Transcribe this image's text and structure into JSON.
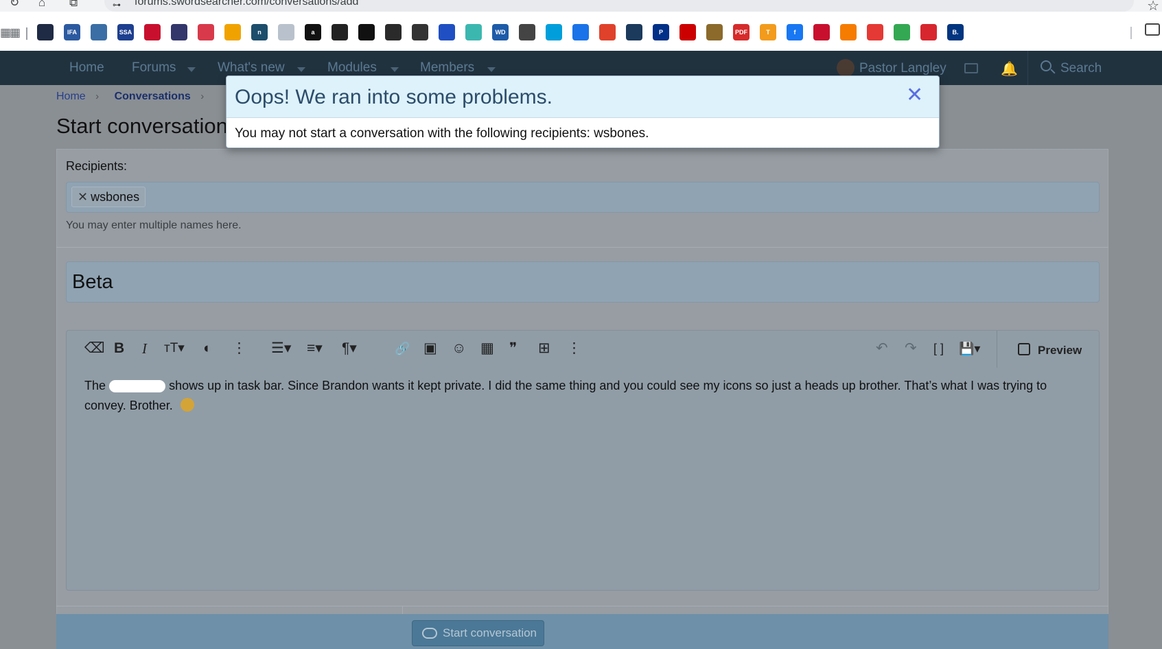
{
  "browser": {
    "url": "forums.swordsearcher.com/conversations/add",
    "nav_reload_glyph": "↻",
    "nav_home_glyph": "⌂",
    "nav_tabs_glyph": "⧉",
    "site_info_glyph": "⊶",
    "star_glyph": "☆",
    "apps_glyph": "▦▦",
    "bookmarks": [
      {
        "label": "",
        "icon": "calendar-icon",
        "color": "#1f2a44"
      },
      {
        "label": "IFA",
        "icon": "ifa-icon",
        "color": "#2c5aa0"
      },
      {
        "label": "",
        "icon": "globe-seal-icon",
        "color": "#3a6ea5"
      },
      {
        "label": "SSA",
        "icon": "ssa-icon",
        "color": "#1d3f8f"
      },
      {
        "label": "",
        "icon": "shield-red-icon",
        "color": "#c8102e"
      },
      {
        "label": "",
        "icon": "usps-icon",
        "color": "#33366b"
      },
      {
        "label": "",
        "icon": "red-envelope-icon",
        "color": "#d83a4b"
      },
      {
        "label": "",
        "icon": "feather-icon",
        "color": "#f0a300"
      },
      {
        "label": "n",
        "icon": "n-icon",
        "color": "#1d4e6b"
      },
      {
        "label": "",
        "icon": "doc-icon",
        "color": "#b9c2cc"
      },
      {
        "label": "a",
        "icon": "amazon-icon",
        "color": "#111111"
      },
      {
        "label": "",
        "icon": "amazon-box-icon",
        "color": "#222222"
      },
      {
        "label": "",
        "icon": "globe-dark-icon",
        "color": "#111111"
      },
      {
        "label": "",
        "icon": "badge-icon",
        "color": "#2a2a2a"
      },
      {
        "label": "",
        "icon": "globe-grey-icon",
        "color": "#333333"
      },
      {
        "label": "",
        "icon": "israel-flag-icon",
        "color": "#1f4fc2"
      },
      {
        "label": "",
        "icon": "leaf-icon",
        "color": "#3bb7b0"
      },
      {
        "label": "WD",
        "icon": "wd-icon",
        "color": "#1d5ba8"
      },
      {
        "label": "",
        "icon": "globe-icon",
        "color": "#444444"
      },
      {
        "label": "",
        "icon": "att-icon",
        "color": "#009fdb"
      },
      {
        "label": "",
        "icon": "g-icon",
        "color": "#1a73e8"
      },
      {
        "label": "",
        "icon": "aarp-icon",
        "color": "#e0412b"
      },
      {
        "label": "",
        "icon": "medal-icon",
        "color": "#1b3a5c"
      },
      {
        "label": "P",
        "icon": "paypal-icon",
        "color": "#003087"
      },
      {
        "label": "",
        "icon": "target-icon",
        "color": "#cc0000"
      },
      {
        "label": "",
        "icon": "crest-icon",
        "color": "#8b6a2b"
      },
      {
        "label": "PDF",
        "icon": "pdf24-icon",
        "color": "#d62b2b"
      },
      {
        "label": "T",
        "icon": "t-icon",
        "color": "#f29b1c"
      },
      {
        "label": "f",
        "icon": "facebook-icon",
        "color": "#1877f2"
      },
      {
        "label": "",
        "icon": "red-card-icon",
        "color": "#c8102e"
      },
      {
        "label": "",
        "icon": "temu-icon",
        "color": "#f57c00"
      },
      {
        "label": "",
        "icon": "download-icon",
        "color": "#e53935"
      },
      {
        "label": "",
        "icon": "meet-icon",
        "color": "#34a853"
      },
      {
        "label": "",
        "icon": "heart-icon",
        "color": "#d7262e"
      },
      {
        "label": "B.",
        "icon": "booking-icon",
        "color": "#003580"
      }
    ]
  },
  "forum_nav": {
    "home": "Home",
    "forums": "Forums",
    "whats_new": "What's new",
    "modules": "Modules",
    "members": "Members",
    "user": "Pastor Langley",
    "search": "Search",
    "bell_glyph": "🔔"
  },
  "breadcrumb": {
    "home": "Home",
    "conversations": "Conversations",
    "sep": "›"
  },
  "page": {
    "title": "Start conversation"
  },
  "form": {
    "recipients_label": "Recipients:",
    "recipient_token": "wsbones",
    "token_remove_glyph": "✕",
    "recipients_hint": "You may enter multiple names here.",
    "title_value": "Beta",
    "message_before": "The",
    "message_after": "shows up in task bar. Since Brandon wants it kept private. I did the same thing and you could see my icons so just a heads up brother. That’s what I was trying to convey. Brother.",
    "preview_label": "Preview",
    "submit_label": "Start conversation"
  },
  "toolbar": {
    "eraser": "⌫",
    "bold": "B",
    "italic": "I",
    "text_size": "тT▾",
    "palette": "◐",
    "more1": "⋮",
    "list": "☰▾",
    "align": "≡▾",
    "paragraph": "¶▾",
    "link": "🔗",
    "image": "▣",
    "smilie": "☺",
    "media": "▦",
    "quote": "❞",
    "table": "⊞",
    "more2": "⋮",
    "undo": "↶",
    "redo": "↷",
    "bbcode": "[ ]",
    "drafts": "💾▾"
  },
  "modal": {
    "title": "Oops! We ran into some problems.",
    "close_glyph": "✕",
    "message": "You may not start a conversation with the following recipients: wsbones."
  },
  "colors": {
    "nav_bg": "#21323f",
    "overlay_gray": "#8a8f94",
    "modal_header_bg": "#ddf2fb",
    "modal_close": "#5a6fe0",
    "submit_bg": "#4b7896"
  }
}
